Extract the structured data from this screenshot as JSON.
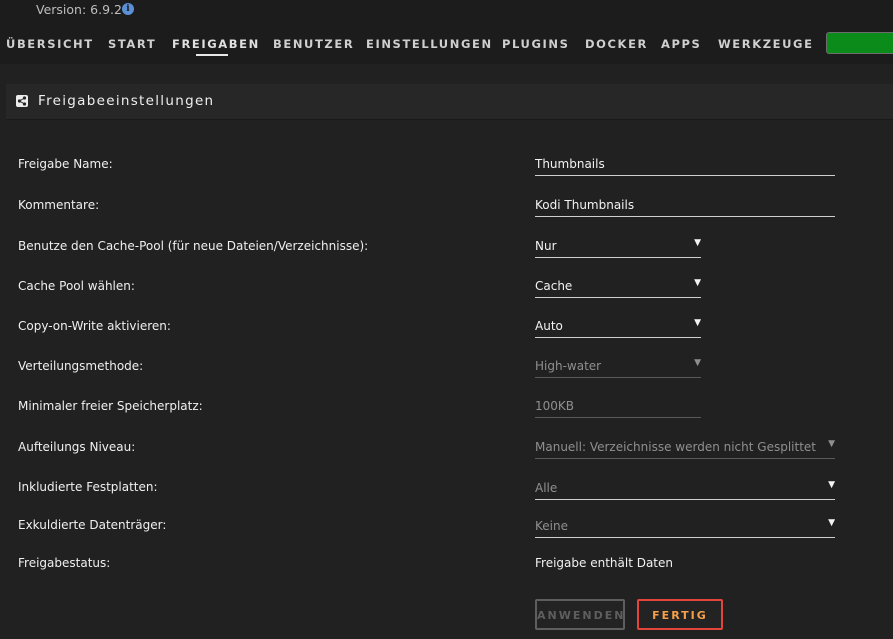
{
  "header": {
    "version": "Version: 6.9.2",
    "info_icon": "info-icon"
  },
  "nav": {
    "items": [
      "ÜBERSICHT",
      "START",
      "FREIGABEN",
      "BENUTZER",
      "EINSTELLUNGEN",
      "PLUGINS",
      "DOCKER",
      "APPS",
      "WERKZEUGE"
    ],
    "active": "FREIGABEN",
    "status_color": "#0b8b1a"
  },
  "section": {
    "icon": "share-icon",
    "title": "Freigabeeinstellungen"
  },
  "form": {
    "rows": [
      {
        "label": "Freigabe Name:",
        "value": "Thumbnails",
        "type": "text",
        "enabled": true
      },
      {
        "label": "Kommentare:",
        "value": "Kodi Thumbnails",
        "type": "text",
        "enabled": true
      },
      {
        "label": "Benutze den Cache-Pool (für neue Dateien/Verzeichnisse):",
        "value": "Nur",
        "type": "select",
        "enabled": true
      },
      {
        "label": "Cache Pool wählen:",
        "value": "Cache",
        "type": "select",
        "enabled": true
      },
      {
        "label": "Copy-on-Write aktivieren:",
        "value": "Auto",
        "type": "select",
        "enabled": true
      },
      {
        "label": "Verteilungsmethode:",
        "value": "High-water",
        "type": "select",
        "enabled": false
      },
      {
        "label": "Minimaler freier Speicherplatz:",
        "value": "100KB",
        "type": "text",
        "enabled": false
      },
      {
        "label": "Aufteilungs Niveau:",
        "value": "Manuell: Verzeichnisse werden nicht Gesplittet",
        "type": "select",
        "enabled": false
      },
      {
        "label": "Inkludierte Festplatten:",
        "value": "Alle",
        "type": "select",
        "enabled": false
      },
      {
        "label": "Exkuldierte Datenträger:",
        "value": "Keine",
        "type": "select",
        "enabled": false
      },
      {
        "label": "Freigabestatus:",
        "value": "Freigabe enthält Daten",
        "type": "static",
        "enabled": false
      }
    ]
  },
  "buttons": {
    "apply": "ANWENDEN",
    "done": "FERTIG"
  },
  "colors": {
    "accent_border": "#e2463b",
    "accent_text": "#f6a04a"
  }
}
